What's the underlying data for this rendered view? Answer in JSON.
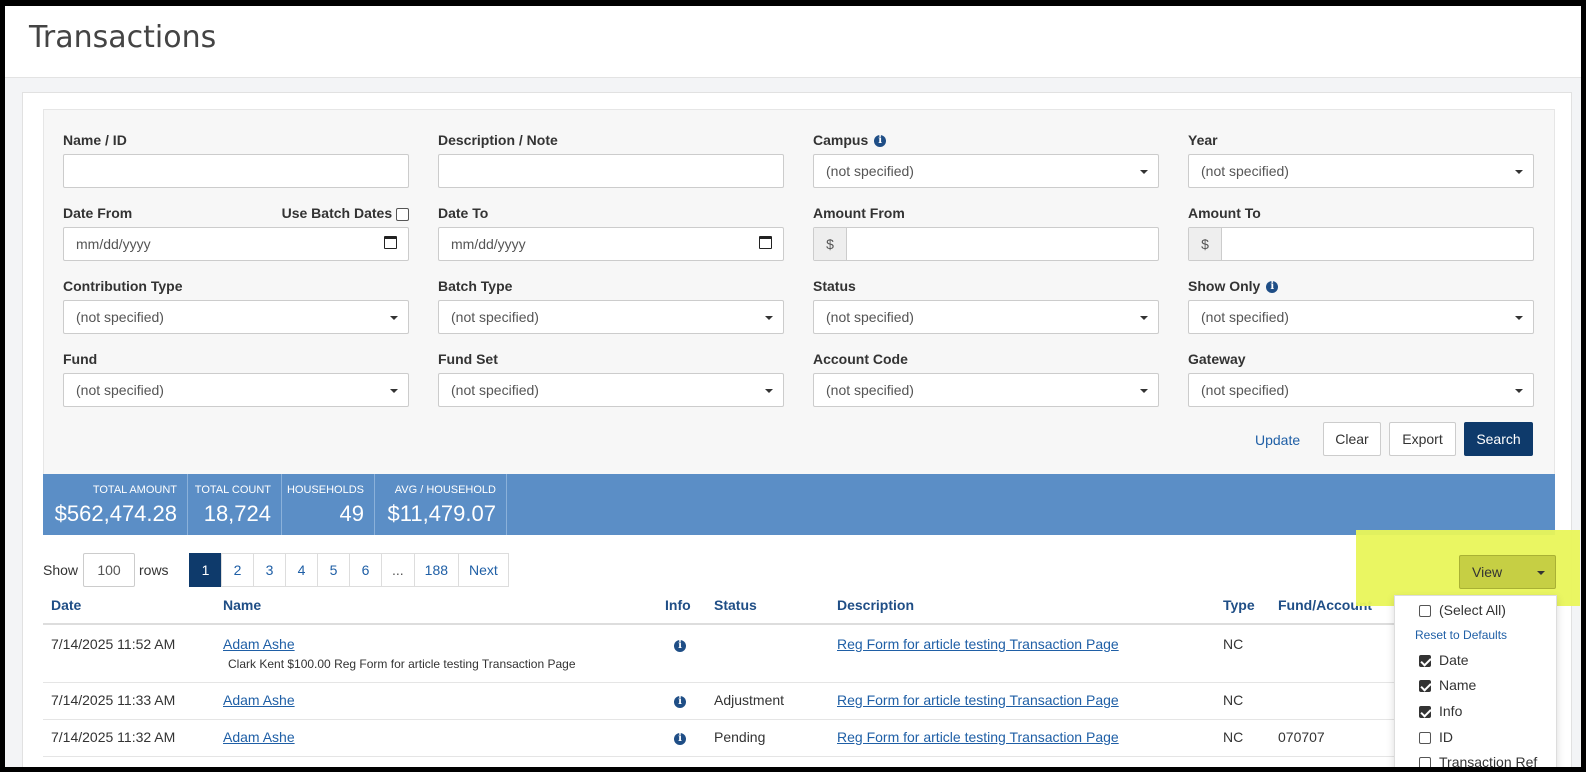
{
  "page": {
    "title": "Transactions"
  },
  "filters": {
    "name_id": {
      "label": "Name / ID",
      "value": ""
    },
    "description_note": {
      "label": "Description / Note",
      "value": ""
    },
    "campus": {
      "label": "Campus",
      "value": "(not specified)"
    },
    "year": {
      "label": "Year",
      "value": "(not specified)"
    },
    "date_from": {
      "label": "Date From",
      "placeholder": "mm/dd/yyyy"
    },
    "use_batch_dates": {
      "label": "Use Batch Dates",
      "checked": false
    },
    "date_to": {
      "label": "Date To",
      "placeholder": "mm/dd/yyyy"
    },
    "amount_from": {
      "label": "Amount From",
      "prefix": "$",
      "value": ""
    },
    "amount_to": {
      "label": "Amount To",
      "prefix": "$",
      "value": ""
    },
    "contribution_type": {
      "label": "Contribution Type",
      "value": "(not specified)"
    },
    "batch_type": {
      "label": "Batch Type",
      "value": "(not specified)"
    },
    "status": {
      "label": "Status",
      "value": "(not specified)"
    },
    "show_only": {
      "label": "Show Only",
      "value": "(not specified)"
    },
    "fund": {
      "label": "Fund",
      "value": "(not specified)"
    },
    "fund_set": {
      "label": "Fund Set",
      "value": "(not specified)"
    },
    "account_code": {
      "label": "Account Code",
      "value": "(not specified)"
    },
    "gateway": {
      "label": "Gateway",
      "value": "(not specified)"
    }
  },
  "actions": {
    "update": "Update",
    "clear": "Clear",
    "export": "Export",
    "search": "Search"
  },
  "stats": [
    {
      "label": "TOTAL AMOUNT",
      "value": "$562,474.28"
    },
    {
      "label": "TOTAL COUNT",
      "value": "18,724"
    },
    {
      "label": "HOUSEHOLDS",
      "value": "49"
    },
    {
      "label": "AVG / HOUSEHOLD",
      "value": "$11,479.07"
    }
  ],
  "paging": {
    "show_label": "Show",
    "rows_value": "100",
    "rows_label": "rows",
    "pages": [
      "1",
      "2",
      "3",
      "4",
      "5",
      "6",
      "...",
      "188",
      "Next"
    ],
    "current": "1"
  },
  "table": {
    "headers": {
      "date": "Date",
      "name": "Name",
      "info": "Info",
      "status": "Status",
      "description": "Description",
      "type": "Type",
      "fund_account": "Fund/Account"
    },
    "rows": [
      {
        "date": "7/14/2025 11:52 AM",
        "name": "Adam Ashe",
        "status": "",
        "description": "Reg Form for article testing Transaction Page",
        "type": "NC",
        "fund": "",
        "sub": "Clark Kent  $100.00  Reg Form for article testing Transaction Page"
      },
      {
        "date": "7/14/2025 11:33 AM",
        "name": "Adam Ashe",
        "status": "Adjustment",
        "description": "Reg Form for article testing Transaction Page",
        "type": "NC",
        "fund": ""
      },
      {
        "date": "7/14/2025 11:32 AM",
        "name": "Adam Ashe",
        "status": "Pending",
        "description": "Reg Form for article testing Transaction Page",
        "type": "NC",
        "fund": "070707"
      }
    ]
  },
  "view_menu": {
    "button": "View",
    "select_all": "(Select All)",
    "reset": "Reset to Defaults",
    "items": [
      {
        "label": "Date",
        "checked": true
      },
      {
        "label": "Name",
        "checked": true
      },
      {
        "label": "Info",
        "checked": true
      },
      {
        "label": "ID",
        "checked": false
      },
      {
        "label": "Transaction Ref",
        "checked": false
      }
    ]
  },
  "colors": {
    "primary": "#0e3a6b",
    "stats_bar": "#5b8ec6",
    "link": "#1f5fa6",
    "highlight": "#e9f55a"
  }
}
